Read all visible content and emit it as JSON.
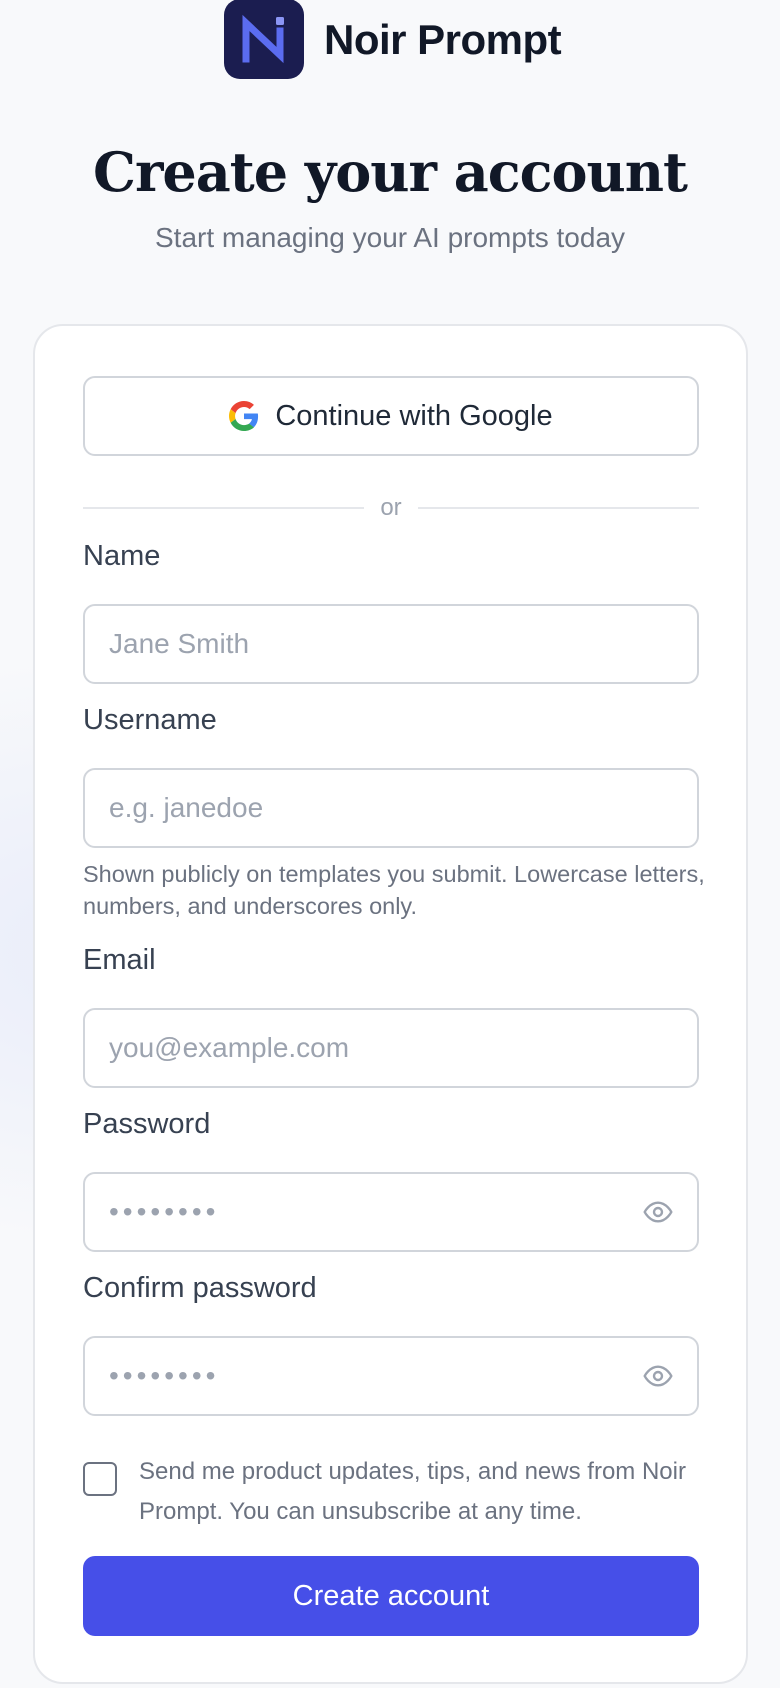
{
  "brand": {
    "name": "Noir Prompt"
  },
  "header": {
    "title": "Create your account",
    "subtitle": "Start managing your AI prompts today"
  },
  "form": {
    "google_button": "Continue with Google",
    "divider": "or",
    "name": {
      "label": "Name",
      "placeholder": "Jane Smith",
      "value": ""
    },
    "username": {
      "label": "Username",
      "placeholder": "e.g. janedoe",
      "value": "",
      "help": "Shown publicly on templates you submit. Lowercase letters, numbers, and underscores only."
    },
    "email": {
      "label": "Email",
      "placeholder": "you@example.com",
      "value": ""
    },
    "password": {
      "label": "Password",
      "placeholder": "••••••••",
      "value": ""
    },
    "confirm_password": {
      "label": "Confirm password",
      "placeholder": "••••••••",
      "value": ""
    },
    "newsletter": {
      "label": "Send me product updates, tips, and news from Noir Prompt. You can unsubscribe at any time.",
      "checked": false
    },
    "submit": "Create account"
  },
  "colors": {
    "primary": "#464fe8",
    "logo_bg": "#1b1d50",
    "logo_mark": "#5b6cf0"
  },
  "icons": {
    "google": "google-logo-icon",
    "eye": "eye-icon",
    "logo": "noir-prompt-logo"
  }
}
